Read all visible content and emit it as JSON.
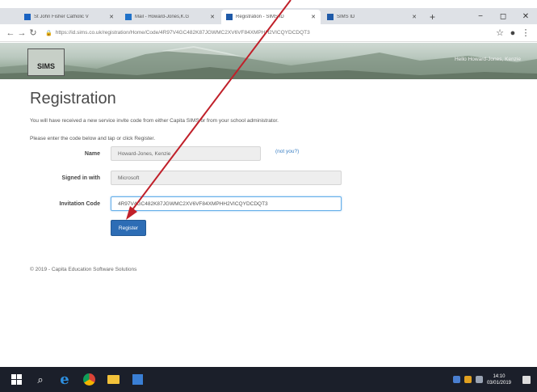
{
  "browser": {
    "tabs": [
      {
        "title": "St John Fisher Catholic V",
        "active": false,
        "icon": "site-icon"
      },
      {
        "title": "Mail - Howard-Jones,K.G",
        "active": false,
        "icon": "mail-icon"
      },
      {
        "title": "Registration - SIMS ID",
        "active": true,
        "icon": "sims-icon"
      },
      {
        "title": "SIMS ID",
        "active": false,
        "icon": "sims-icon"
      }
    ],
    "new_tab": "+",
    "url": "https://id.sims.co.uk/registration/Home/Code/4R97V4GC482K87JGWMC2XV6VF84XMPHH2VICQYDCDQT3",
    "window_controls": [
      "−",
      "◻",
      "✕"
    ]
  },
  "header": {
    "logo": "SIMS",
    "greeting": "Hello Howard-Jones, Kenzie"
  },
  "main": {
    "title": "Registration",
    "intro": "You will have received a new service invite code from either Capita SIMS or from your school administrator.",
    "instruction": "Please enter the code below and tap or click Register.",
    "fields": {
      "name_label": "Name",
      "name_value": "Howard-Jones, Kenzie",
      "not_you": "(not you?)",
      "signed_in_label": "Signed in with",
      "signed_in_value": "Microsoft",
      "code_label": "Invitation Code",
      "code_value": "4R97V4GC482K87JGWMC2XV6VF84XMPHH2VICQYDCDQT3"
    },
    "register_label": "Register"
  },
  "footer": {
    "text": "© 2019 - Capita Education Software Solutions"
  },
  "taskbar": {
    "clock_time": "14:10",
    "clock_date": "03/01/2019"
  },
  "colors": {
    "accent": "#2d6db5",
    "link": "#3a7fc3",
    "annotation_arrow": "#c0202a"
  }
}
